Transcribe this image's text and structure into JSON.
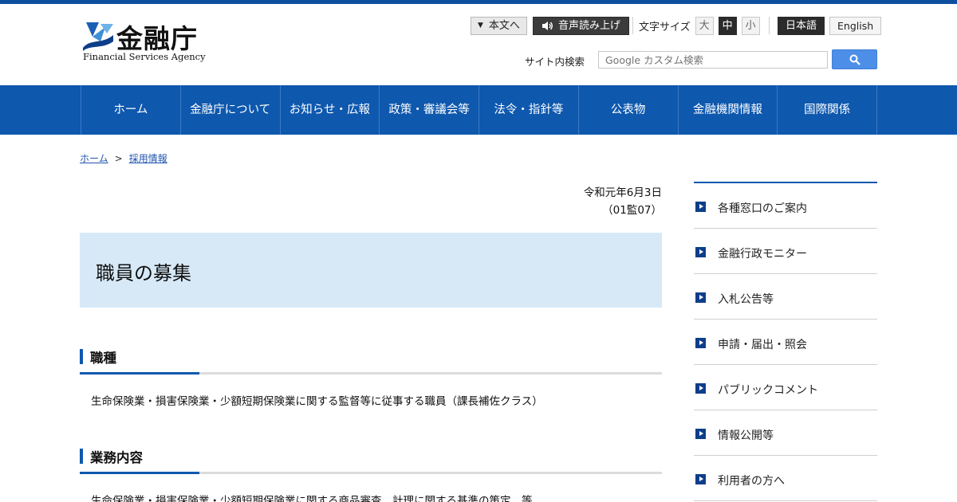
{
  "header": {
    "logo_name": "金融庁",
    "logo_en": "Financial Services Agency",
    "skip_label": "本文へ",
    "voice_label": "音声読み上げ",
    "font_size_label": "文字サイズ",
    "font_sizes": [
      "大",
      "中",
      "小"
    ],
    "lang_ja": "日本語",
    "lang_en": "English",
    "search_label": "サイト内検索",
    "search_placeholder": "Google カスタム検索"
  },
  "nav": {
    "items": [
      "ホーム",
      "金融庁について",
      "お知らせ・広報",
      "政策・審議会等",
      "法令・指針等",
      "公表物",
      "金融機関情報",
      "国際関係"
    ]
  },
  "breadcrumb": {
    "home": "ホーム",
    "separator": ">",
    "current": "採用情報"
  },
  "main": {
    "date": "令和元年6月3日",
    "code": "（01監07）",
    "title": "職員の募集",
    "sections": [
      {
        "heading": "職種",
        "text": "生命保険業・損害保険業・少額短期保険業に関する監督等に従事する職員（課長補佐クラス）"
      },
      {
        "heading": "業務内容",
        "text": "生命保険業・損害保険業・少額短期保険業に関する商品審査、計理に関する基準の策定　等"
      }
    ]
  },
  "sidebar": {
    "items": [
      "各種窓口のご案内",
      "金融行政モニター",
      "入札公告等",
      "申請・届出・照会",
      "パブリックコメント",
      "情報公開等",
      "利用者の方へ"
    ]
  },
  "colors": {
    "brand_blue": "#0e58ae",
    "title_bg": "#d7e9f7",
    "search_button": "#4d8ee8"
  }
}
